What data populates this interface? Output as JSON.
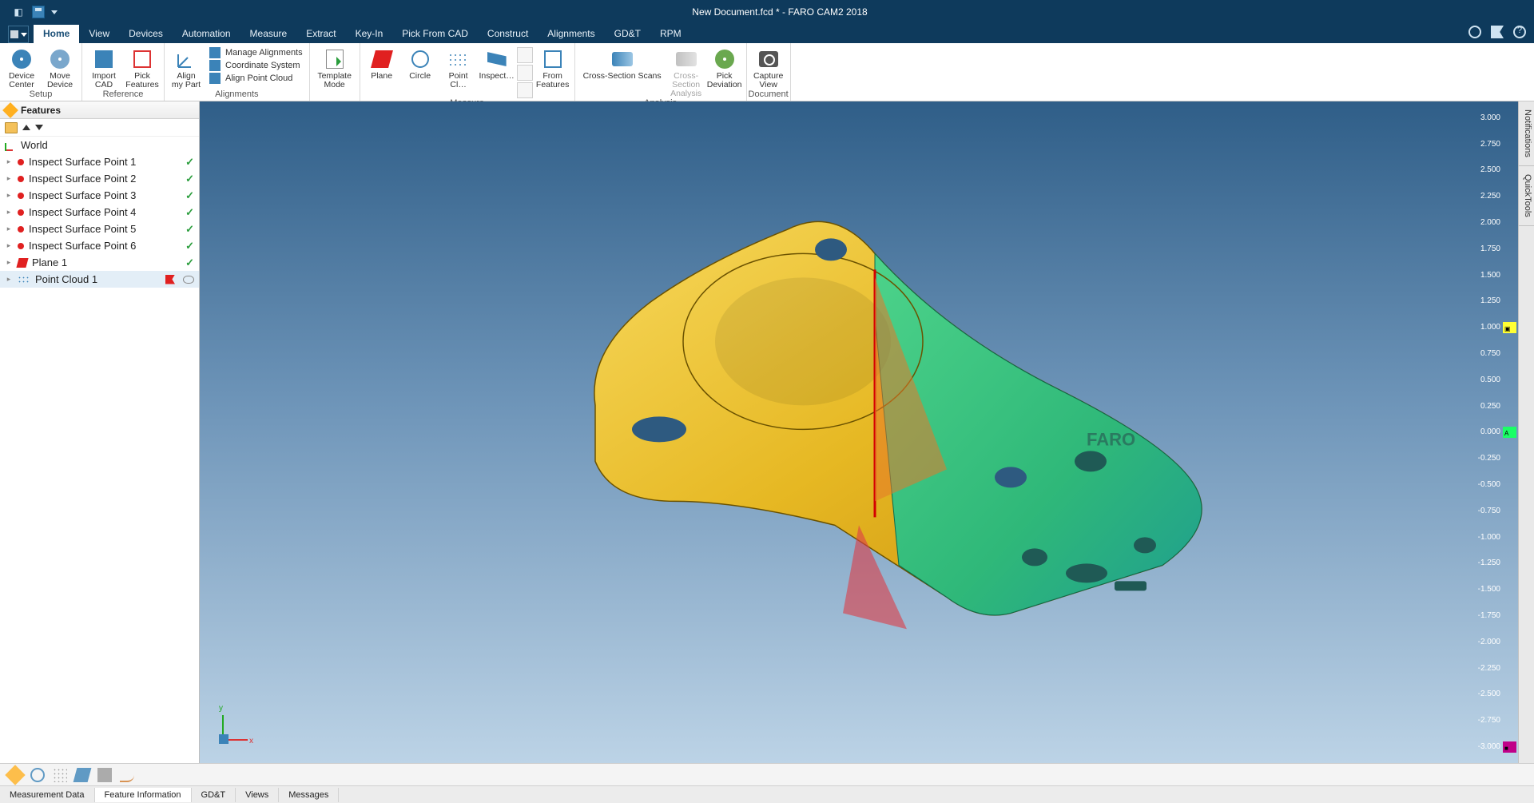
{
  "title": "New Document.fcd * - FARO CAM2 2018",
  "menus": [
    "Home",
    "View",
    "Devices",
    "Automation",
    "Measure",
    "Extract",
    "Key-In",
    "Pick From CAD",
    "Construct",
    "Alignments",
    "GD&T",
    "RPM"
  ],
  "active_menu": "Home",
  "ribbon": {
    "setup": {
      "label": "Setup",
      "device_center": "Device\nCenter",
      "move_device": "Move\nDevice"
    },
    "reference": {
      "label": "Reference",
      "import_cad": "Import\nCAD",
      "pick_features": "Pick\nFeatures"
    },
    "alignments": {
      "label": "Alignments",
      "align_my_part": "Align\nmy Part",
      "items": [
        "Manage Alignments",
        "Coordinate System",
        "Align Point Cloud"
      ]
    },
    "template": {
      "mode": "Template\nMode"
    },
    "measure": {
      "label": "Measure",
      "plane": "Plane",
      "circle": "Circle",
      "point_cloud": "Point Cl…",
      "inspect": "Inspect…",
      "from_features": "From\nFeatures"
    },
    "analysis": {
      "label": "Analysis",
      "cross_section_scans": "Cross-Section Scans",
      "cross_section_analysis": "Cross-Section\nAnalysis",
      "pick_deviation": "Pick\nDeviation"
    },
    "document": {
      "label": "Document",
      "capture_view": "Capture\nView"
    }
  },
  "features_panel": {
    "title": "Features",
    "items": [
      {
        "kind": "world",
        "label": "World"
      },
      {
        "kind": "point",
        "label": "Inspect Surface Point 1",
        "ok": true
      },
      {
        "kind": "point",
        "label": "Inspect Surface Point 2",
        "ok": true
      },
      {
        "kind": "point",
        "label": "Inspect Surface Point 3",
        "ok": true
      },
      {
        "kind": "point",
        "label": "Inspect Surface Point 4",
        "ok": true
      },
      {
        "kind": "point",
        "label": "Inspect Surface Point 5",
        "ok": true
      },
      {
        "kind": "point",
        "label": "Inspect Surface Point 6",
        "ok": true
      },
      {
        "kind": "plane",
        "label": "Plane 1",
        "ok": true
      },
      {
        "kind": "cloud",
        "label": "Point Cloud 1",
        "flag": true,
        "selected": true
      }
    ]
  },
  "side_tabs": [
    "Notifications",
    "QuickTools"
  ],
  "triad": {
    "x": "x",
    "y": "y"
  },
  "color_scale": {
    "values": [
      "3.000",
      "2.750",
      "2.500",
      "2.250",
      "2.000",
      "1.750",
      "1.500",
      "1.250",
      "1.000",
      "0.750",
      "0.500",
      "0.250",
      "0.000",
      "-0.250",
      "-0.500",
      "-0.750",
      "-1.000",
      "-1.250",
      "-1.500",
      "-1.750",
      "-2.000",
      "-2.250",
      "-2.500",
      "-2.750",
      "-3.000"
    ],
    "colors": [
      "#8b0000",
      "#b30000",
      "#d40000",
      "#ff1a00",
      "#ff5500",
      "#ff8800",
      "#ffb000",
      "#ffe000",
      "#ffff33",
      "#d4ff33",
      "#9cff33",
      "#5cff33",
      "#1aff66",
      "#00e699",
      "#00cccc",
      "#00b3e6",
      "#0099ff",
      "#3380ff",
      "#5c66ff",
      "#7a55f0",
      "#8c40e0",
      "#9d2cd0",
      "#ae1ac0",
      "#bf0dab",
      "#c00088"
    ],
    "markers": {
      "8": "▣",
      "12": "A",
      "24": "■"
    }
  },
  "bottom_tabs": [
    "Measurement Data",
    "Feature Information",
    "GD&T",
    "Views",
    "Messages"
  ],
  "active_bottom": "Feature Information",
  "part_logo": "FARO"
}
